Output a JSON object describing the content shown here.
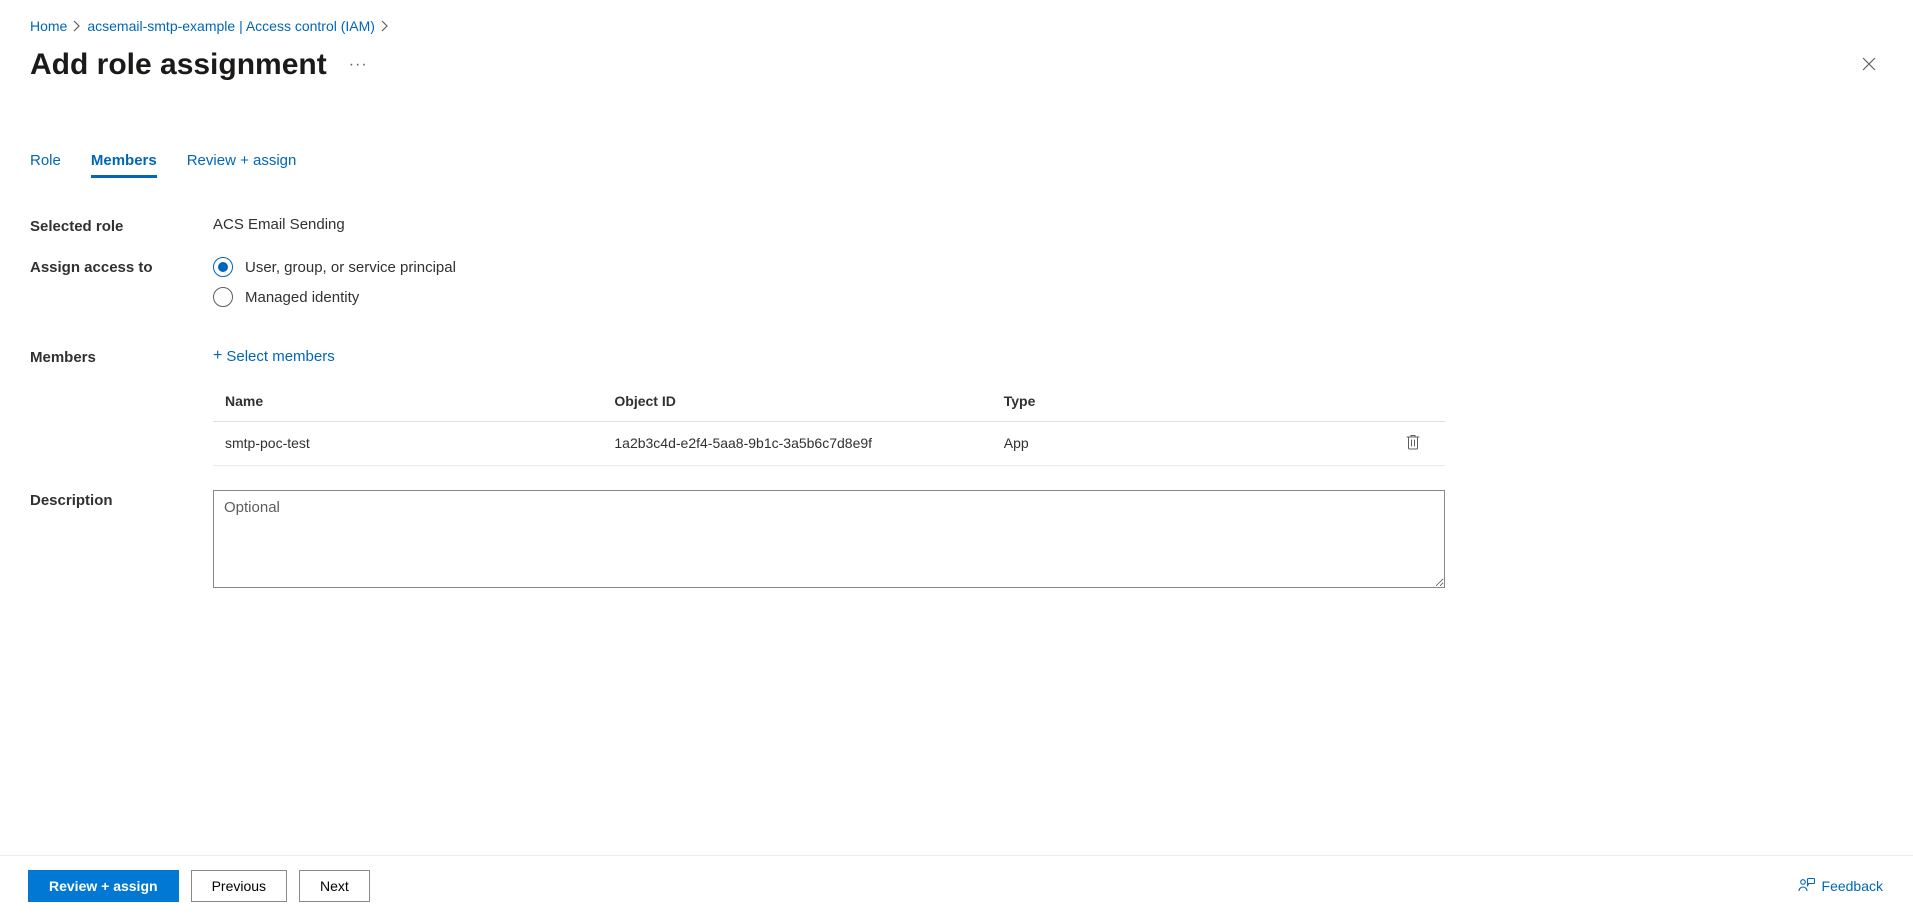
{
  "breadcrumb": {
    "home": "Home",
    "iam": "acsemail-smtp-example | Access control (IAM)"
  },
  "page_title": "Add role assignment",
  "tabs": {
    "role": "Role",
    "members": "Members",
    "review": "Review + assign",
    "active": "members"
  },
  "labels": {
    "selected_role": "Selected role",
    "assign_access_to": "Assign access to",
    "members": "Members",
    "description": "Description"
  },
  "values": {
    "selected_role": "ACS Email Sending"
  },
  "assign_access_options": {
    "option1": "User, group, or service principal",
    "option2": "Managed identity",
    "selected": "option1"
  },
  "select_members_label": "Select members",
  "members_table": {
    "headers": {
      "name": "Name",
      "object_id": "Object ID",
      "type": "Type"
    },
    "rows": [
      {
        "name": "smtp-poc-test",
        "object_id": "1a2b3c4d-e2f4-5aa8-9b1c-3a5b6c7d8e9f",
        "type": "App"
      }
    ]
  },
  "description_placeholder": "Optional",
  "description_value": "",
  "footer": {
    "review_assign": "Review + assign",
    "previous": "Previous",
    "next": "Next",
    "feedback": "Feedback"
  }
}
